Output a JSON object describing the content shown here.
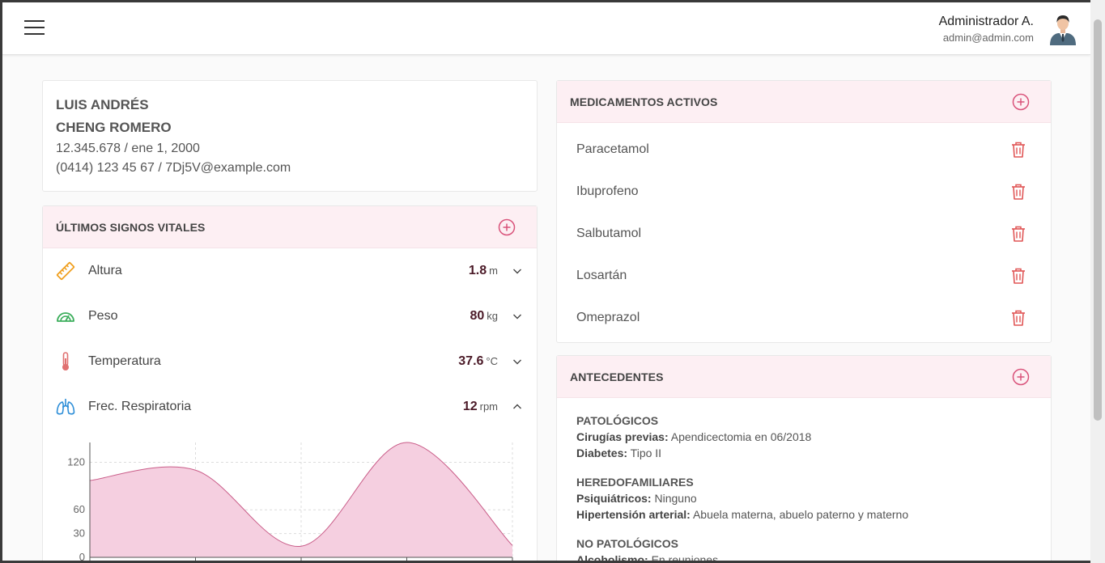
{
  "user": {
    "name": "Administrador A.",
    "email": "admin@admin.com"
  },
  "patient": {
    "first_name": "LUIS ANDRÉS",
    "last_name": "CHENG ROMERO",
    "id_birth": "12.345.678 / ene 1, 2000",
    "contact": "(0414) 123 45 67 / 7Dj5V@example.com"
  },
  "vitals": {
    "title": "ÚLTIMOS SIGNOS VITALES",
    "items": [
      {
        "label": "Altura",
        "value": "1.8",
        "unit": "m",
        "icon": "ruler-icon",
        "expanded": false
      },
      {
        "label": "Peso",
        "value": "80",
        "unit": "kg",
        "icon": "gauge-icon",
        "expanded": false
      },
      {
        "label": "Temperatura",
        "value": "37.6",
        "unit": "°C",
        "icon": "thermometer-icon",
        "expanded": false
      },
      {
        "label": "Frec. Respiratoria",
        "value": "12",
        "unit": "rpm",
        "icon": "lungs-icon",
        "expanded": true
      }
    ]
  },
  "chart_data": {
    "type": "area",
    "x": [
      0,
      1,
      2,
      3,
      4
    ],
    "values": [
      97,
      110,
      14,
      145,
      15
    ],
    "ylim": [
      0,
      145
    ],
    "yticks": [
      "120",
      "60",
      "30",
      "0"
    ],
    "grid": true,
    "colors": {
      "fill": "#f5cfe0",
      "stroke": "#c95c88"
    }
  },
  "medications": {
    "title": "MEDICAMENTOS ACTIVOS",
    "items": [
      "Paracetamol",
      "Ibuprofeno",
      "Salbutamol",
      "Losartán",
      "Omeprazol"
    ]
  },
  "antecedentes": {
    "title": "ANTECEDENTES",
    "sections": [
      {
        "heading": "PATOLÓGICOS",
        "entries": [
          {
            "key": "Cirugías previas:",
            "value": "Apendicectomia en 06/2018"
          },
          {
            "key": "Diabetes:",
            "value": "Tipo II"
          }
        ]
      },
      {
        "heading": "HEREDOFAMILIARES",
        "entries": [
          {
            "key": "Psiquiátricos:",
            "value": "Ninguno"
          },
          {
            "key": "Hipertensión arterial:",
            "value": "Abuela materna, abuelo paterno y materno"
          }
        ]
      },
      {
        "heading": "NO PATOLÓGICOS",
        "entries": [
          {
            "key": "Alcoholismo:",
            "value": "En reuniones"
          }
        ]
      }
    ]
  },
  "colors": {
    "accent": "#d9527a",
    "header_bg": "#fdeff3",
    "ruler": "#f0a020",
    "gauge": "#3cae5c",
    "thermo": "#e07070",
    "lungs": "#2f8fd8",
    "trash": "#e05555"
  }
}
